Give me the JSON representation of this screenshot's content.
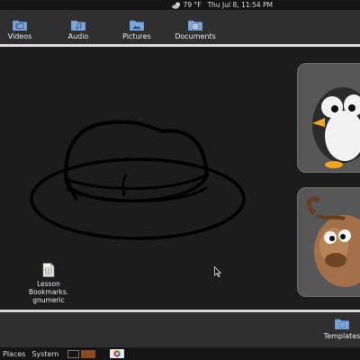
{
  "top_panel": {
    "weather": "79 °F",
    "datetime": "Thu Jul  8, 11:54 PM",
    "weather_icon": "cloudy-moon-icon"
  },
  "shelf_top": {
    "items": [
      {
        "label": "Videos",
        "icon": "video-folder-icon"
      },
      {
        "label": "Audio",
        "icon": "music-folder-icon"
      },
      {
        "label": "Pictures",
        "icon": "pictures-folder-icon"
      },
      {
        "label": "Documents",
        "icon": "documents-folder-icon"
      }
    ]
  },
  "desktop": {
    "background_art": "hat-outline",
    "file": {
      "label": "Lesson\nBookmarks.\ngnumeric",
      "icon": "spreadsheet-file-icon"
    },
    "tiles": [
      {
        "icon": "penguin-icon"
      },
      {
        "icon": "gnu-icon"
      }
    ]
  },
  "shelf_bottom": {
    "items": [
      {
        "label": "Templates",
        "icon": "templates-folder-icon"
      }
    ]
  },
  "taskbar": {
    "menus": [
      "Places",
      "System"
    ],
    "launcher_icon": "browser-icon"
  },
  "colors": {
    "folder": "#7aa6d8",
    "panel": "#141414",
    "shelf": "#2f2f2f",
    "desktop": "#1c1c1c",
    "tile": "#575757",
    "workspace_active": "#8a4a1a"
  }
}
